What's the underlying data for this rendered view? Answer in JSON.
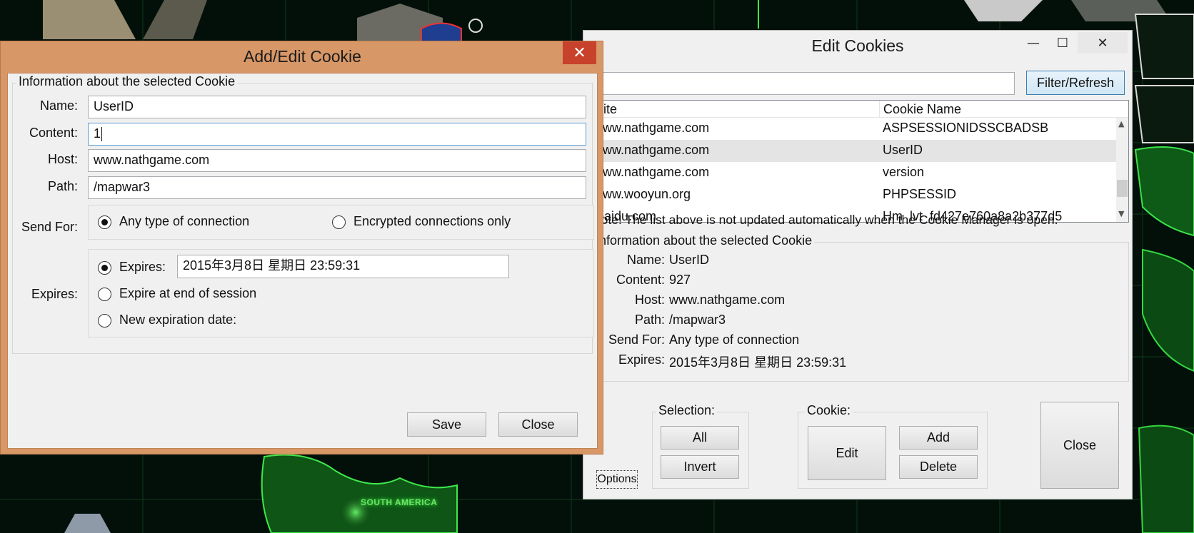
{
  "background": {
    "map_label": "SOUTH AMERICA"
  },
  "edit_cookies": {
    "title": "Edit Cookies",
    "minimize_glyph": "—",
    "maximize_glyph": "☐",
    "close_glyph": "✕",
    "filter_value": "",
    "filter_button": "Filter/Refresh",
    "columns": [
      "Site",
      "Cookie Name"
    ],
    "rows": [
      {
        "site": "www.nathgame.com",
        "name": "ASPSESSIONIDSSCBADSB"
      },
      {
        "site": "www.nathgame.com",
        "name": "UserID"
      },
      {
        "site": "www.nathgame.com",
        "name": "version"
      },
      {
        "site": "www.wooyun.org",
        "name": "PHPSESSID"
      },
      {
        "site": ".baidu.com",
        "name": "Hm_lvt_fd427e760a8a2b377d5"
      }
    ],
    "selected_row": 1,
    "note": "Note! The list above is not updated automatically when the Cookie Manager is open.",
    "info_legend": "Information about the selected Cookie",
    "info": {
      "name_label": "Name:",
      "name": "UserID",
      "content_label": "Content:",
      "content": "927",
      "host_label": "Host:",
      "host": "www.nathgame.com",
      "path_label": "Path:",
      "path": "/mapwar3",
      "sendfor_label": "Send For:",
      "sendfor": "Any type of connection",
      "expires_label": "Expires:",
      "expires": "2015年3月8日 星期日 23:59:31"
    },
    "selection_legend": "Selection:",
    "all_button": "All",
    "invert_button": "Invert",
    "cookie_legend": "Cookie:",
    "edit_button": "Edit",
    "add_button": "Add",
    "delete_button": "Delete",
    "close_button": "Close",
    "options_button": "Options"
  },
  "add_edit_cookie": {
    "title": "Add/Edit Cookie",
    "close_glyph": "✕",
    "legend": "Information about the selected Cookie",
    "name_label": "Name:",
    "name_value": "UserID",
    "content_label": "Content:",
    "content_value": "1",
    "host_label": "Host:",
    "host_value": "www.nathgame.com",
    "path_label": "Path:",
    "path_value": "/mapwar3",
    "sendfor_label": "Send For:",
    "sendfor_options": [
      "Any type of connection",
      "Encrypted connections only"
    ],
    "sendfor_selected": 0,
    "expires_label": "Expires:",
    "expires_option_label": "Expires:",
    "expires_value": "2015年3月8日 星期日 23:59:31",
    "expire_session_label": "Expire at end of session",
    "new_expiration_label": "New expiration date:",
    "expires_selected": 0,
    "save_button": "Save",
    "close_button": "Close",
    "accent_color": "#d89766",
    "close_button_color": "#c7412b"
  }
}
